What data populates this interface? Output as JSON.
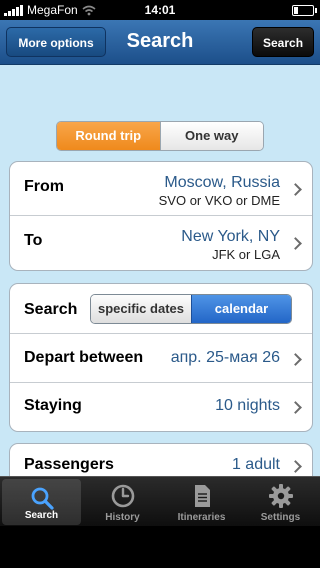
{
  "status": {
    "carrier": "MegaFon",
    "time": "14:01"
  },
  "nav": {
    "title": "Search",
    "more_options": "More options",
    "search": "Search"
  },
  "trip_type": {
    "options": [
      "Round trip",
      "One way"
    ],
    "selected": "Round trip"
  },
  "route": {
    "from": {
      "label": "From",
      "city": "Moscow, Russia",
      "airports": "SVO or VKO or DME"
    },
    "to": {
      "label": "To",
      "city": "New York, NY",
      "airports": "JFK or LGA"
    }
  },
  "dates": {
    "search_label": "Search",
    "modes": [
      "specific dates",
      "calendar"
    ],
    "selected_mode": "calendar",
    "depart_label": "Depart between",
    "depart_value": "апр. 25-мая 26",
    "staying_label": "Staying",
    "staying_value": "10 nights"
  },
  "passengers": {
    "label": "Passengers",
    "value": "1 adult"
  },
  "tabs": [
    {
      "label": "Search",
      "icon": "search-icon",
      "active": true
    },
    {
      "label": "History",
      "icon": "clock-icon",
      "active": false
    },
    {
      "label": "Itineraries",
      "icon": "document-icon",
      "active": false
    },
    {
      "label": "Settings",
      "icon": "gear-icon",
      "active": false
    }
  ],
  "colors": {
    "accent_orange": "#ef8a1c",
    "accent_blue": "#2366c7",
    "nav_blue": "#1c4f8a",
    "value_blue": "#2b5a8a",
    "background": "#c9e7f6"
  }
}
